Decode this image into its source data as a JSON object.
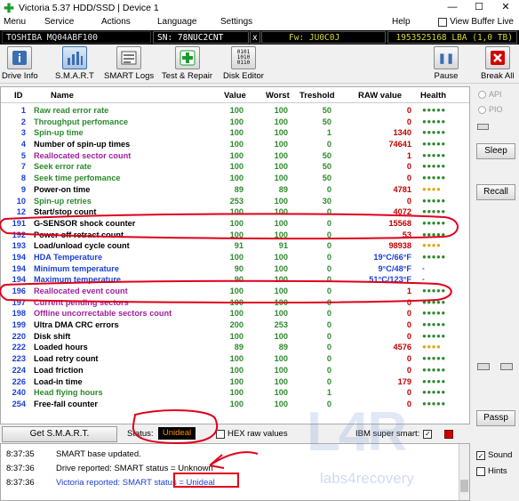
{
  "window": {
    "title": "Victoria 5.37 HDD/SSD | Device 1",
    "app_icon": "cross-icon",
    "controls": [
      "—",
      "☐",
      "✕"
    ]
  },
  "menu": {
    "items": [
      "Menu",
      "Service",
      "Actions",
      "Language",
      "Settings",
      "Help"
    ],
    "view_buffer_live": "View Buffer Live"
  },
  "drive": {
    "model": "TOSHIBA MQ04ABF100",
    "serial": "SN: 78NUC2CNT",
    "close": "x",
    "firmware": "Fw: JU0C0J",
    "capacity": "1953525168 LBA (1,0 TB)"
  },
  "toolbar": {
    "buttons": [
      "Drive Info",
      "S.M.A.R.T",
      "SMART Logs",
      "Test & Repair",
      "Disk Editor"
    ],
    "pause": "Pause",
    "break_all": "Break All"
  },
  "table": {
    "headers": [
      "ID",
      "Name",
      "Value",
      "Worst",
      "Treshold",
      "RAW value",
      "Health"
    ],
    "rows": [
      {
        "id": "1",
        "name": "Raw read error rate",
        "value": "100",
        "worst": "100",
        "thr": "50",
        "raw": "0",
        "health": "●●●●●",
        "nc": "#2d8a2d",
        "rc": "#c00000",
        "hc": "#2d8a2d"
      },
      {
        "id": "2",
        "name": "Throughput perfomance",
        "value": "100",
        "worst": "100",
        "thr": "50",
        "raw": "0",
        "health": "●●●●●",
        "nc": "#2d8a2d",
        "rc": "#c00000",
        "hc": "#2d8a2d"
      },
      {
        "id": "3",
        "name": "Spin-up time",
        "value": "100",
        "worst": "100",
        "thr": "1",
        "raw": "1340",
        "health": "●●●●●",
        "nc": "#2d8a2d",
        "rc": "#c00000",
        "hc": "#2d8a2d"
      },
      {
        "id": "4",
        "name": "Number of spin-up times",
        "value": "100",
        "worst": "100",
        "thr": "0",
        "raw": "74641",
        "health": "●●●●●",
        "nc": "#000000",
        "rc": "#c00000",
        "hc": "#2d8a2d"
      },
      {
        "id": "5",
        "name": "Reallocated sector count",
        "value": "100",
        "worst": "100",
        "thr": "50",
        "raw": "1",
        "health": "●●●●●",
        "nc": "#a020a0",
        "rc": "#c00000",
        "hc": "#2d8a2d"
      },
      {
        "id": "7",
        "name": "Seek error rate",
        "value": "100",
        "worst": "100",
        "thr": "50",
        "raw": "0",
        "health": "●●●●●",
        "nc": "#2d8a2d",
        "rc": "#c00000",
        "hc": "#2d8a2d"
      },
      {
        "id": "8",
        "name": "Seek time perfomance",
        "value": "100",
        "worst": "100",
        "thr": "50",
        "raw": "0",
        "health": "●●●●●",
        "nc": "#2d8a2d",
        "rc": "#c00000",
        "hc": "#2d8a2d"
      },
      {
        "id": "9",
        "name": "Power-on time",
        "value": "89",
        "worst": "89",
        "thr": "0",
        "raw": "4781",
        "health": "●●●●",
        "nc": "#000000",
        "rc": "#c00000",
        "hc": "#e0a800"
      },
      {
        "id": "10",
        "name": "Spin-up retries",
        "value": "253",
        "worst": "100",
        "thr": "30",
        "raw": "0",
        "health": "●●●●●",
        "nc": "#2d8a2d",
        "rc": "#c00000",
        "hc": "#2d8a2d"
      },
      {
        "id": "12",
        "name": "Start/stop count",
        "value": "100",
        "worst": "100",
        "thr": "0",
        "raw": "4072",
        "health": "●●●●●",
        "nc": "#000000",
        "rc": "#c00000",
        "hc": "#2d8a2d"
      },
      {
        "id": "191",
        "name": "G-SENSOR shock counter",
        "value": "100",
        "worst": "100",
        "thr": "0",
        "raw": "15568",
        "health": "●●●●●",
        "nc": "#000000",
        "rc": "#c00000",
        "hc": "#2d8a2d"
      },
      {
        "id": "192",
        "name": "Power-off retract count",
        "value": "100",
        "worst": "100",
        "thr": "0",
        "raw": "53",
        "health": "●●●●●",
        "nc": "#000000",
        "rc": "#c00000",
        "hc": "#2d8a2d"
      },
      {
        "id": "193",
        "name": "Load/unload cycle count",
        "value": "91",
        "worst": "91",
        "thr": "0",
        "raw": "98938",
        "health": "●●●●",
        "nc": "#000000",
        "rc": "#c00000",
        "hc": "#e0a800"
      },
      {
        "id": "194",
        "name": "HDA Temperature",
        "value": "100",
        "worst": "100",
        "thr": "0",
        "raw": "19°C/66°F",
        "health": "●●●●●",
        "nc": "#1a3fd6",
        "rc": "#1a3fd6",
        "hc": "#2d8a2d"
      },
      {
        "id": "194",
        "name": "Minimum temperature",
        "value": "90",
        "worst": "100",
        "thr": "0",
        "raw": "9°C/48°F",
        "health": "-",
        "nc": "#1a3fd6",
        "rc": "#1a3fd6",
        "hc": "#1a3fd6"
      },
      {
        "id": "194",
        "name": "Maximum temperature",
        "value": "90",
        "worst": "100",
        "thr": "0",
        "raw": "51°C/123°F",
        "health": "-",
        "nc": "#1a3fd6",
        "rc": "#1a3fd6",
        "hc": "#1a3fd6"
      },
      {
        "id": "196",
        "name": "Reallocated event count",
        "value": "100",
        "worst": "100",
        "thr": "0",
        "raw": "1",
        "health": "●●●●●",
        "nc": "#a020a0",
        "rc": "#c00000",
        "hc": "#2d8a2d"
      },
      {
        "id": "197",
        "name": "Current pending sectors",
        "value": "100",
        "worst": "100",
        "thr": "0",
        "raw": "0",
        "health": "●●●●●",
        "nc": "#a020a0",
        "rc": "#c00000",
        "hc": "#2d8a2d"
      },
      {
        "id": "198",
        "name": "Offline uncorrectable sectors count",
        "value": "100",
        "worst": "100",
        "thr": "0",
        "raw": "0",
        "health": "●●●●●",
        "nc": "#a020a0",
        "rc": "#c00000",
        "hc": "#2d8a2d"
      },
      {
        "id": "199",
        "name": "Ultra DMA CRC errors",
        "value": "200",
        "worst": "253",
        "thr": "0",
        "raw": "0",
        "health": "●●●●●",
        "nc": "#000000",
        "rc": "#c00000",
        "hc": "#2d8a2d"
      },
      {
        "id": "220",
        "name": "Disk shift",
        "value": "100",
        "worst": "100",
        "thr": "0",
        "raw": "0",
        "health": "●●●●●",
        "nc": "#000000",
        "rc": "#c00000",
        "hc": "#2d8a2d"
      },
      {
        "id": "222",
        "name": "Loaded hours",
        "value": "89",
        "worst": "89",
        "thr": "0",
        "raw": "4576",
        "health": "●●●●",
        "nc": "#000000",
        "rc": "#c00000",
        "hc": "#e0a800"
      },
      {
        "id": "223",
        "name": "Load retry count",
        "value": "100",
        "worst": "100",
        "thr": "0",
        "raw": "0",
        "health": "●●●●●",
        "nc": "#000000",
        "rc": "#c00000",
        "hc": "#2d8a2d"
      },
      {
        "id": "224",
        "name": "Load friction",
        "value": "100",
        "worst": "100",
        "thr": "0",
        "raw": "0",
        "health": "●●●●●",
        "nc": "#000000",
        "rc": "#c00000",
        "hc": "#2d8a2d"
      },
      {
        "id": "226",
        "name": "Load-in time",
        "value": "100",
        "worst": "100",
        "thr": "0",
        "raw": "179",
        "health": "●●●●●",
        "nc": "#000000",
        "rc": "#c00000",
        "hc": "#2d8a2d"
      },
      {
        "id": "240",
        "name": "Head flying hours",
        "value": "100",
        "worst": "100",
        "thr": "1",
        "raw": "0",
        "health": "●●●●●",
        "nc": "#2d8a2d",
        "rc": "#c00000",
        "hc": "#2d8a2d"
      },
      {
        "id": "254",
        "name": "Free-fall counter",
        "value": "100",
        "worst": "100",
        "thr": "0",
        "raw": "0",
        "health": "●●●●●",
        "nc": "#000000",
        "rc": "#c00000",
        "hc": "#2d8a2d"
      }
    ]
  },
  "side": {
    "api": "API",
    "pio": "PIO",
    "sleep": "Sleep",
    "recall": "Recall",
    "passp": "Passp"
  },
  "status_bar": {
    "get_smart": "Get S.M.A.R.T.",
    "status_label": "Status:",
    "status_value": "Unideal",
    "hex_raw": "HEX raw values",
    "ibm": "IBM super smart:",
    "ibm_check": "✓"
  },
  "log": [
    {
      "time": "8:37:35",
      "msg": "SMART base updated."
    },
    {
      "time": "8:37:36",
      "msg": "Drive reported: SMART status = Unknown"
    },
    {
      "time": "8:37:36",
      "msg": "Victoria reported: SMART status = Unideal"
    }
  ],
  "bottom_side": {
    "sound": "Sound",
    "sound_check": "✓",
    "hints": "Hints"
  },
  "watermark": {
    "logo": "L4R",
    "text": "labs4recovery"
  },
  "colors": {
    "accent": "#3b6eb0",
    "annotation": "#e0001b",
    "ok": "#2d8a2d",
    "warn": "#e0a800",
    "raw": "#c00000",
    "temp": "#1a3fd6"
  }
}
